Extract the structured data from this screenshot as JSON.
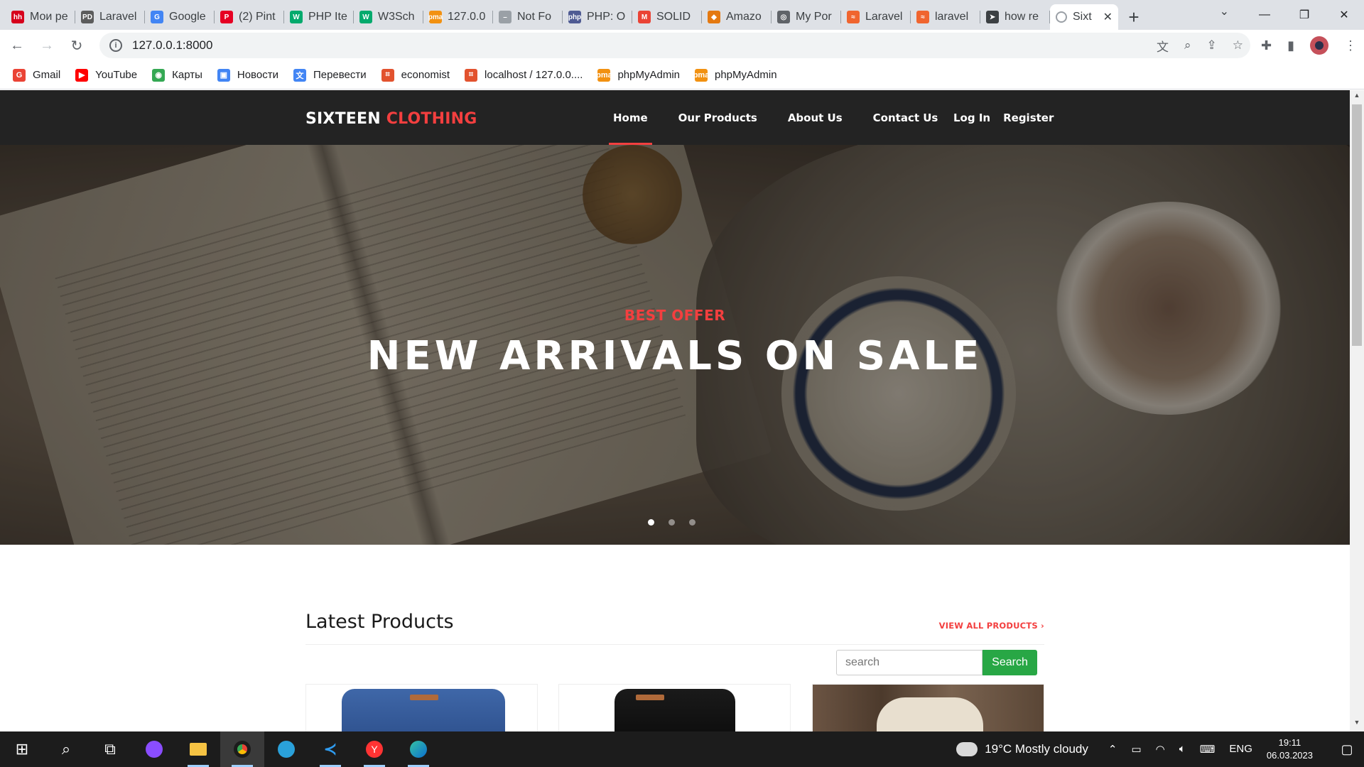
{
  "browser": {
    "tabs": [
      {
        "label": "Мои ре",
        "color": "#d6001c",
        "glyph": "hh"
      },
      {
        "label": "Laravel",
        "color": "#5c5c5c",
        "glyph": "PD"
      },
      {
        "label": "Google",
        "color": "#4285f4",
        "glyph": "G"
      },
      {
        "label": "(2) Pint",
        "color": "#e60023",
        "glyph": "P"
      },
      {
        "label": "PHP Ite",
        "color": "#04aa6d",
        "glyph": "W"
      },
      {
        "label": "W3Sch",
        "color": "#04aa6d",
        "glyph": "W"
      },
      {
        "label": "127.0.0",
        "color": "#f29111",
        "glyph": "pma"
      },
      {
        "label": "Not Fo",
        "color": "#9aa0a6",
        "glyph": "–"
      },
      {
        "label": "PHP: O",
        "color": "#4f5b93",
        "glyph": "php"
      },
      {
        "label": "SOLID",
        "color": "#ea4335",
        "glyph": "M"
      },
      {
        "label": "Amazo",
        "color": "#e47911",
        "glyph": "◆"
      },
      {
        "label": "My Por",
        "color": "#5f6368",
        "glyph": "◎"
      },
      {
        "label": "Laravel",
        "color": "#f0652f",
        "glyph": "≈"
      },
      {
        "label": "laravel",
        "color": "#f0652f",
        "glyph": "≈"
      },
      {
        "label": "how re",
        "color": "#3c4043",
        "glyph": "➤"
      }
    ],
    "active_tab": {
      "label": "Sixt",
      "close": "✕"
    },
    "new_tab": "+",
    "url": "127.0.0.1:8000",
    "bookmarks": [
      {
        "label": "Gmail",
        "color": "#ea4335",
        "glyph": "G"
      },
      {
        "label": "YouTube",
        "color": "#ff0000",
        "glyph": "▶"
      },
      {
        "label": "Карты",
        "color": "#34a853",
        "glyph": "◉"
      },
      {
        "label": "Новости",
        "color": "#4285f4",
        "glyph": "▣"
      },
      {
        "label": "Перевести",
        "color": "#4285f4",
        "glyph": "文"
      },
      {
        "label": "economist",
        "color": "#e2522e",
        "glyph": "⌗"
      },
      {
        "label": "localhost / 127.0.0....",
        "color": "#e2522e",
        "glyph": "⌗"
      },
      {
        "label": "phpMyAdmin",
        "color": "#f29111",
        "glyph": "pma"
      },
      {
        "label": "phpMyAdmin",
        "color": "#f29111",
        "glyph": "pma"
      }
    ]
  },
  "site": {
    "logo_main": "SIXTEEN",
    "logo_accent": "CLOTHING",
    "nav": [
      "Home",
      "Our Products",
      "About Us",
      "Contact Us"
    ],
    "auth": {
      "login": "Log In",
      "register": "Register"
    },
    "hero": {
      "subtitle": "BEST OFFER",
      "title": "NEW ARRIVALS ON SALE",
      "slides": 3,
      "active_slide": 1
    },
    "latest": {
      "title": "Latest Products",
      "view_all": "VIEW ALL PRODUCTS ›"
    },
    "search": {
      "placeholder": "search",
      "button": "Search"
    }
  },
  "taskbar": {
    "weather": "19°C  Mostly cloudy",
    "lang": "ENG",
    "time": "19:11",
    "date": "06.03.2023"
  },
  "colors": {
    "accent": "#f33f3f",
    "header_bg": "#232323",
    "search_btn": "#28a745"
  }
}
